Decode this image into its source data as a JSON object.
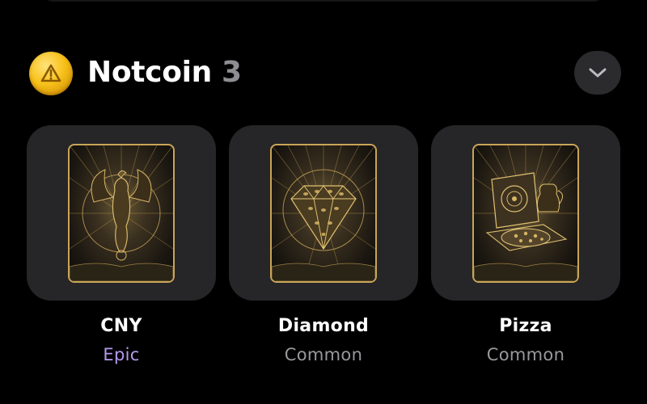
{
  "collection": {
    "title": "Notcoin",
    "count": "3",
    "icon": "notcoin-icon",
    "collapse_icon": "chevron-down-icon"
  },
  "cards": [
    {
      "name": "CNY",
      "rarity": "Epic",
      "rarity_color": "#b399ee",
      "art_icon": "dragon-icon"
    },
    {
      "name": "Diamond",
      "rarity": "Common",
      "rarity_color": "#98989d",
      "art_icon": "diamond-icon"
    },
    {
      "name": "Pizza",
      "rarity": "Common",
      "rarity_color": "#98989d",
      "art_icon": "pizza-icon"
    }
  ],
  "colors": {
    "background": "#000000",
    "tile": "#262628",
    "accent_gold": "#c9a558",
    "coin": "#f8c21c"
  }
}
